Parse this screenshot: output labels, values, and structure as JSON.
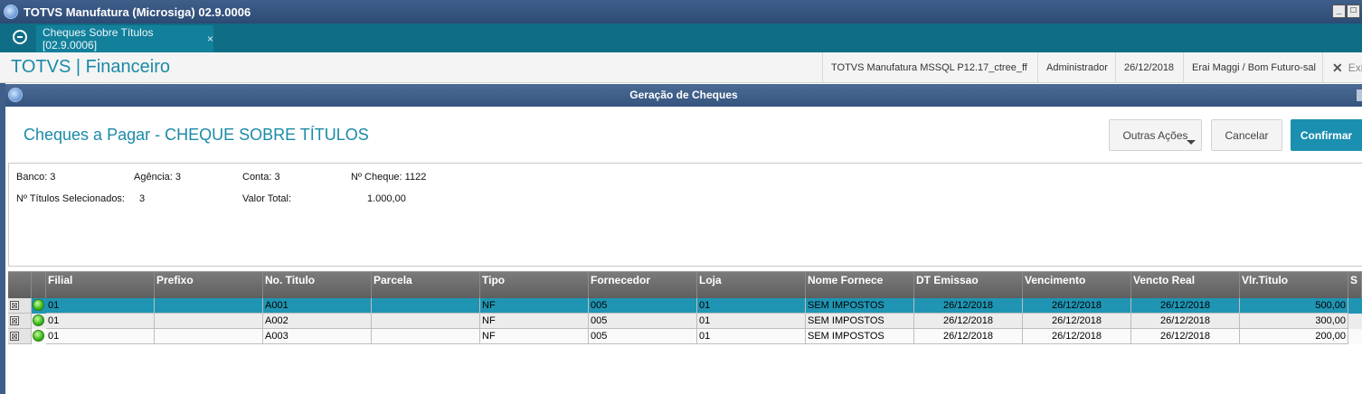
{
  "window": {
    "title": "TOTVS Manufatura (Microsiga) 02.9.0006",
    "min_label": "_",
    "max_label": "□"
  },
  "tabs": {
    "active_label": "Cheques Sobre Títulos [02.9.0006]",
    "close_label": "×"
  },
  "header": {
    "brand": "TOTVS | Financeiro",
    "environment": "TOTVS Manufatura MSSQL P12.17_ctree_ff",
    "user": "Administrador",
    "date": "26/12/2018",
    "company": "Erai Maggi / Bom Futuro-sal",
    "logout_label": "Exi"
  },
  "dialog": {
    "title": "Geração de Cheques"
  },
  "page": {
    "title": "Cheques a Pagar - CHEQUE SOBRE TÍTULOS",
    "buttons": {
      "other_actions": "Outras Ações",
      "cancel": "Cancelar",
      "confirm": "Confirmar"
    }
  },
  "info": {
    "banco": "Banco: 3",
    "agencia": "Agência: 3",
    "conta": "Conta: 3",
    "cheque": "Nº Cheque: 1122",
    "titulos_label": "Nº Títulos Selecionados:",
    "titulos_value": "3",
    "valor_label": "Valor Total:",
    "valor_value": "1.000,00"
  },
  "grid": {
    "columns": [
      "Filial",
      "Prefixo",
      "No. Titulo",
      "Parcela",
      "Tipo",
      "Fornecedor",
      "Loja",
      "Nome Fornece",
      "DT Emissao",
      "Vencimento",
      "Vencto Real",
      "Vlr.Titulo",
      "S"
    ],
    "rows": [
      {
        "check": "⊠",
        "filial": "01",
        "prefixo": "",
        "titulo": "A001",
        "parcela": "",
        "tipo": "NF",
        "fornecedor": "005",
        "loja": "01",
        "nome": "SEM IMPOSTOS",
        "emissao": "26/12/2018",
        "vencimento": "26/12/2018",
        "vencto_real": "26/12/2018",
        "valor": "500,00"
      },
      {
        "check": "⊠",
        "filial": "01",
        "prefixo": "",
        "titulo": "A002",
        "parcela": "",
        "tipo": "NF",
        "fornecedor": "005",
        "loja": "01",
        "nome": "SEM IMPOSTOS",
        "emissao": "26/12/2018",
        "vencimento": "26/12/2018",
        "vencto_real": "26/12/2018",
        "valor": "300,00"
      },
      {
        "check": "⊠",
        "filial": "01",
        "prefixo": "",
        "titulo": "A003",
        "parcela": "",
        "tipo": "NF",
        "fornecedor": "005",
        "loja": "01",
        "nome": "SEM IMPOSTOS",
        "emissao": "26/12/2018",
        "vencimento": "26/12/2018",
        "vencto_real": "26/12/2018",
        "valor": "200,00"
      }
    ]
  }
}
